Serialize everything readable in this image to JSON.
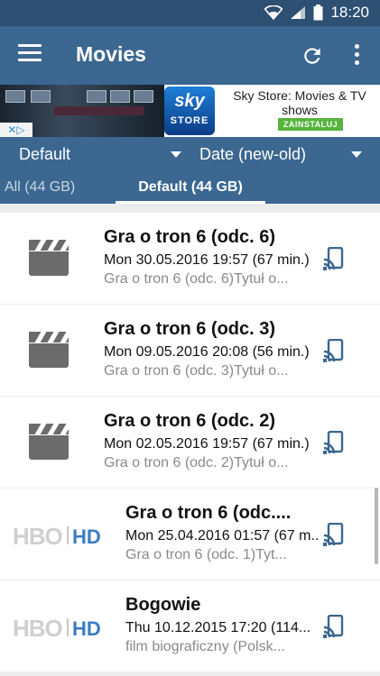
{
  "status": {
    "time": "18:20"
  },
  "appbar": {
    "title": "Movies"
  },
  "ad": {
    "title": "Sky Store: Movies & TV shows",
    "logo_line1": "sky",
    "logo_line2": "STORE",
    "install_label": "ZAINSTALUJ"
  },
  "filters": {
    "group": "Default",
    "sort": "Date (new-old)"
  },
  "tabs": [
    {
      "label": "All (44 GB)"
    },
    {
      "label": "Default (44 GB)"
    }
  ],
  "items": [
    {
      "thumb": "clapperboard-icon",
      "title": "Gra o tron 6 (odc. 6)",
      "date": "Mon 30.05.2016 19:57 (67 min.)",
      "desc": "Gra o tron 6 (odc. 6)Tytuł o..."
    },
    {
      "thumb": "clapperboard-icon",
      "title": "Gra o tron 6 (odc. 3)",
      "date": "Mon 09.05.2016 20:08 (56 min.)",
      "desc": "Gra o tron 6 (odc. 3)Tytuł o..."
    },
    {
      "thumb": "clapperboard-icon",
      "title": "Gra o tron 6 (odc. 2)",
      "date": "Mon 02.05.2016 19:57 (67 min.)",
      "desc": "Gra o tron 6 (odc. 2)Tytuł o..."
    },
    {
      "thumb": "hbo-hd-logo",
      "title": "Gra o tron 6 (odc....",
      "date": "Mon 25.04.2016 01:57 (67 m...",
      "desc": "Gra o tron 6 (odc. 1)Tyt...",
      "logo_hbo": "HBO",
      "logo_hd": "HD"
    },
    {
      "thumb": "hbo-hd-logo",
      "title": "Bogowie",
      "date": "Thu 10.12.2015 17:20 (114...",
      "desc": "film biograficzny (Polsk...",
      "logo_hbo": "HBO",
      "logo_hd": "HD"
    }
  ]
}
